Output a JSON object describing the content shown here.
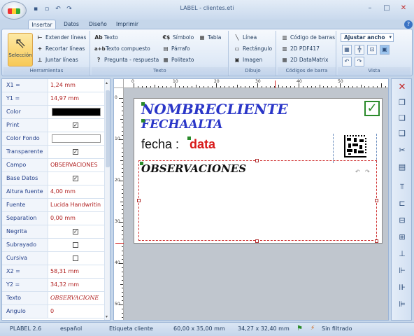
{
  "window": {
    "title": "LABEL - clientes.eti",
    "help": "?"
  },
  "tabs": [
    "Insertar",
    "Datos",
    "Diseño",
    "Imprimir"
  ],
  "ribbon": {
    "herramientas": {
      "label": "Herramientas",
      "seleccion": "Selección",
      "extender": "Extender líneas",
      "recortar": "Recortar líneas",
      "juntar": "Juntar líneas"
    },
    "texto": {
      "label": "Texto",
      "texto": "Texto",
      "compuesto": "Texto compuesto",
      "pregunta": "Pregunta - respuesta",
      "simbolo": "Símbolo",
      "parrafo": "Párrafo",
      "politexto": "Politexto",
      "tabla": "Tabla",
      "icon_ab": "Ab",
      "icon_ab2": "a+b",
      "icon_q": "?",
      "icon_sym": "€$"
    },
    "dibujo": {
      "label": "Dibujo",
      "linea": "Línea",
      "rectangulo": "Rectángulo",
      "imagen": "Imagen"
    },
    "codigos": {
      "label": "Códigos de barra",
      "barras": "Código de barras",
      "pdf417": "2D PDF417",
      "datamatrix": "2D DataMatrix"
    },
    "vista": {
      "label": "Vista",
      "ajustar": "Ajustar ancho"
    }
  },
  "properties": [
    {
      "name": "X1 =",
      "value": "1,24 mm"
    },
    {
      "name": "Y1 =",
      "value": "14,97 mm"
    },
    {
      "name": "Color",
      "swatch": "#000000"
    },
    {
      "name": "Print",
      "check": true
    },
    {
      "name": "Color Fondo",
      "swatch": "#ffffff"
    },
    {
      "name": "Transparente",
      "check": true
    },
    {
      "name": "Campo",
      "value": "OBSERVACIONES"
    },
    {
      "name": "Base Datos",
      "check": true
    },
    {
      "name": "Altura fuente",
      "value": "4,00 mm"
    },
    {
      "name": "Fuente",
      "value": "Lucida Handwritin"
    },
    {
      "name": "Separation",
      "value": "0,00 mm"
    },
    {
      "name": "Negrita",
      "check": true
    },
    {
      "name": "Subrayado",
      "check": false
    },
    {
      "name": "Cursiva",
      "check": false
    },
    {
      "name": "X2 =",
      "value": "58,31 mm"
    },
    {
      "name": "Y2 =",
      "value": "34,32 mm"
    },
    {
      "name": "Texto",
      "value": "OBSERVACIONE",
      "italic": true
    },
    {
      "name": "Angulo",
      "value": "0"
    }
  ],
  "ruler": {
    "h": [
      "0",
      "10",
      "20",
      "30",
      "40",
      "50"
    ],
    "v": [
      "0",
      "10",
      "20",
      "30",
      "40",
      "50"
    ]
  },
  "label": {
    "nombre": "NOMBRECLIENTE",
    "fecha_alta": "FECHAALTA",
    "fecha_text": "fecha :",
    "data_text": "data",
    "observaciones": "OBSERVACIONES",
    "check": "✓"
  },
  "status": {
    "version": "PLABEL 2.6",
    "language": "español",
    "label_name": "Etiqueta cliente",
    "size": "60,00 x 35,00 mm",
    "cursor": "34,27 x 32,40 mm",
    "filter": "Sin filtrado"
  },
  "colors": {
    "accent": "#2a36c8",
    "red": "#d81a1a",
    "value_red": "#b02020"
  }
}
